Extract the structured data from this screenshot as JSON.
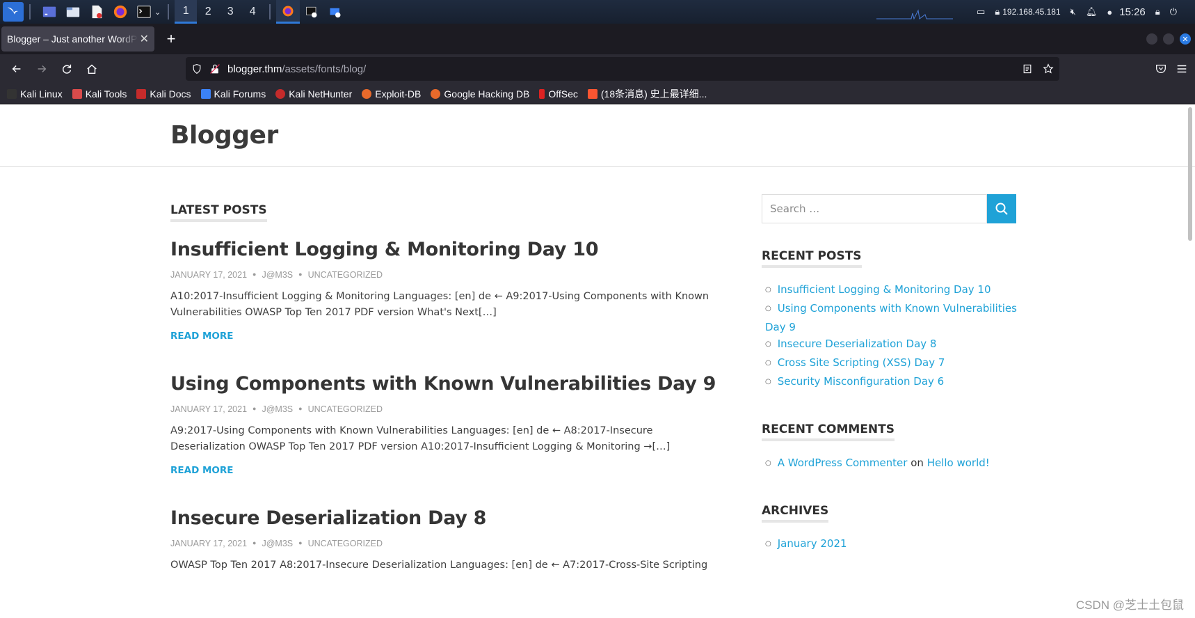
{
  "taskbar": {
    "workspaces": [
      "1",
      "2",
      "3",
      "4"
    ],
    "active_workspace": "1",
    "ip": "192.168.45.181",
    "clock": "15:26"
  },
  "browser": {
    "tab_title": "Blogger – Just another WordPress site",
    "new_tab": "+",
    "url_host": "blogger.thm",
    "url_path": "/assets/fonts/blog/",
    "bookmarks": [
      {
        "label": "Kali Linux",
        "color": "#222"
      },
      {
        "label": "Kali Tools",
        "color": "#d94b4b"
      },
      {
        "label": "Kali Docs",
        "color": "#c52b2b"
      },
      {
        "label": "Kali Forums",
        "color": "#3b82f6"
      },
      {
        "label": "Kali NetHunter",
        "color": "#c42b2b"
      },
      {
        "label": "Exploit-DB",
        "color": "#e86a2b"
      },
      {
        "label": "Google Hacking DB",
        "color": "#e86a2b"
      },
      {
        "label": "OffSec",
        "color": "#d22"
      },
      {
        "label": "(18条消息) 史上最详细...",
        "color": "#fc5531"
      }
    ]
  },
  "site": {
    "title": "Blogger",
    "latest_heading": "LATEST POSTS",
    "posts": [
      {
        "title": "Insufficient Logging & Monitoring Day 10",
        "date": "JANUARY 17, 2021",
        "author": "J@M3S",
        "category": "UNCATEGORIZED",
        "excerpt": "A10:2017-Insufficient Logging & Monitoring Languages: [en] de ← A9:2017-Using Components with Known Vulnerabilities OWASP Top Ten 2017 PDF version What's Next[…]",
        "read_more": "READ MORE"
      },
      {
        "title": "Using Components with Known Vulnerabilities Day 9",
        "date": "JANUARY 17, 2021",
        "author": "J@M3S",
        "category": "UNCATEGORIZED",
        "excerpt": "A9:2017-Using Components with Known Vulnerabilities Languages: [en] de ← A8:2017-Insecure Deserialization OWASP Top Ten 2017 PDF version A10:2017-Insufficient Logging & Monitoring →[…]",
        "read_more": "READ MORE"
      },
      {
        "title": "Insecure Deserialization Day 8",
        "date": "JANUARY 17, 2021",
        "author": "J@M3S",
        "category": "UNCATEGORIZED",
        "excerpt": "OWASP Top Ten 2017 A8:2017-Insecure Deserialization Languages: [en] de ← A7:2017-Cross-Site Scripting"
      }
    ]
  },
  "sidebar": {
    "search_placeholder": "Search …",
    "recent_posts_heading": "RECENT POSTS",
    "recent_posts": [
      "Insufficient Logging & Monitoring Day 10",
      "Using Components with Known Vulnerabilities Day 9",
      "Insecure Deserialization Day 8",
      "Cross Site Scripting (XSS) Day 7",
      "Security Misconfiguration Day 6"
    ],
    "recent_comments_heading": "RECENT COMMENTS",
    "comment_author": "A WordPress Commenter",
    "comment_on": "on",
    "comment_post": "Hello world!",
    "archives_heading": "ARCHIVES",
    "archives": [
      "January 2021"
    ]
  },
  "watermark": "CSDN @芝士土包鼠",
  "colors": {
    "accent": "#1fa2d7",
    "taskbar": "#1f2b3f",
    "browser_chrome": "#2b2a33"
  }
}
